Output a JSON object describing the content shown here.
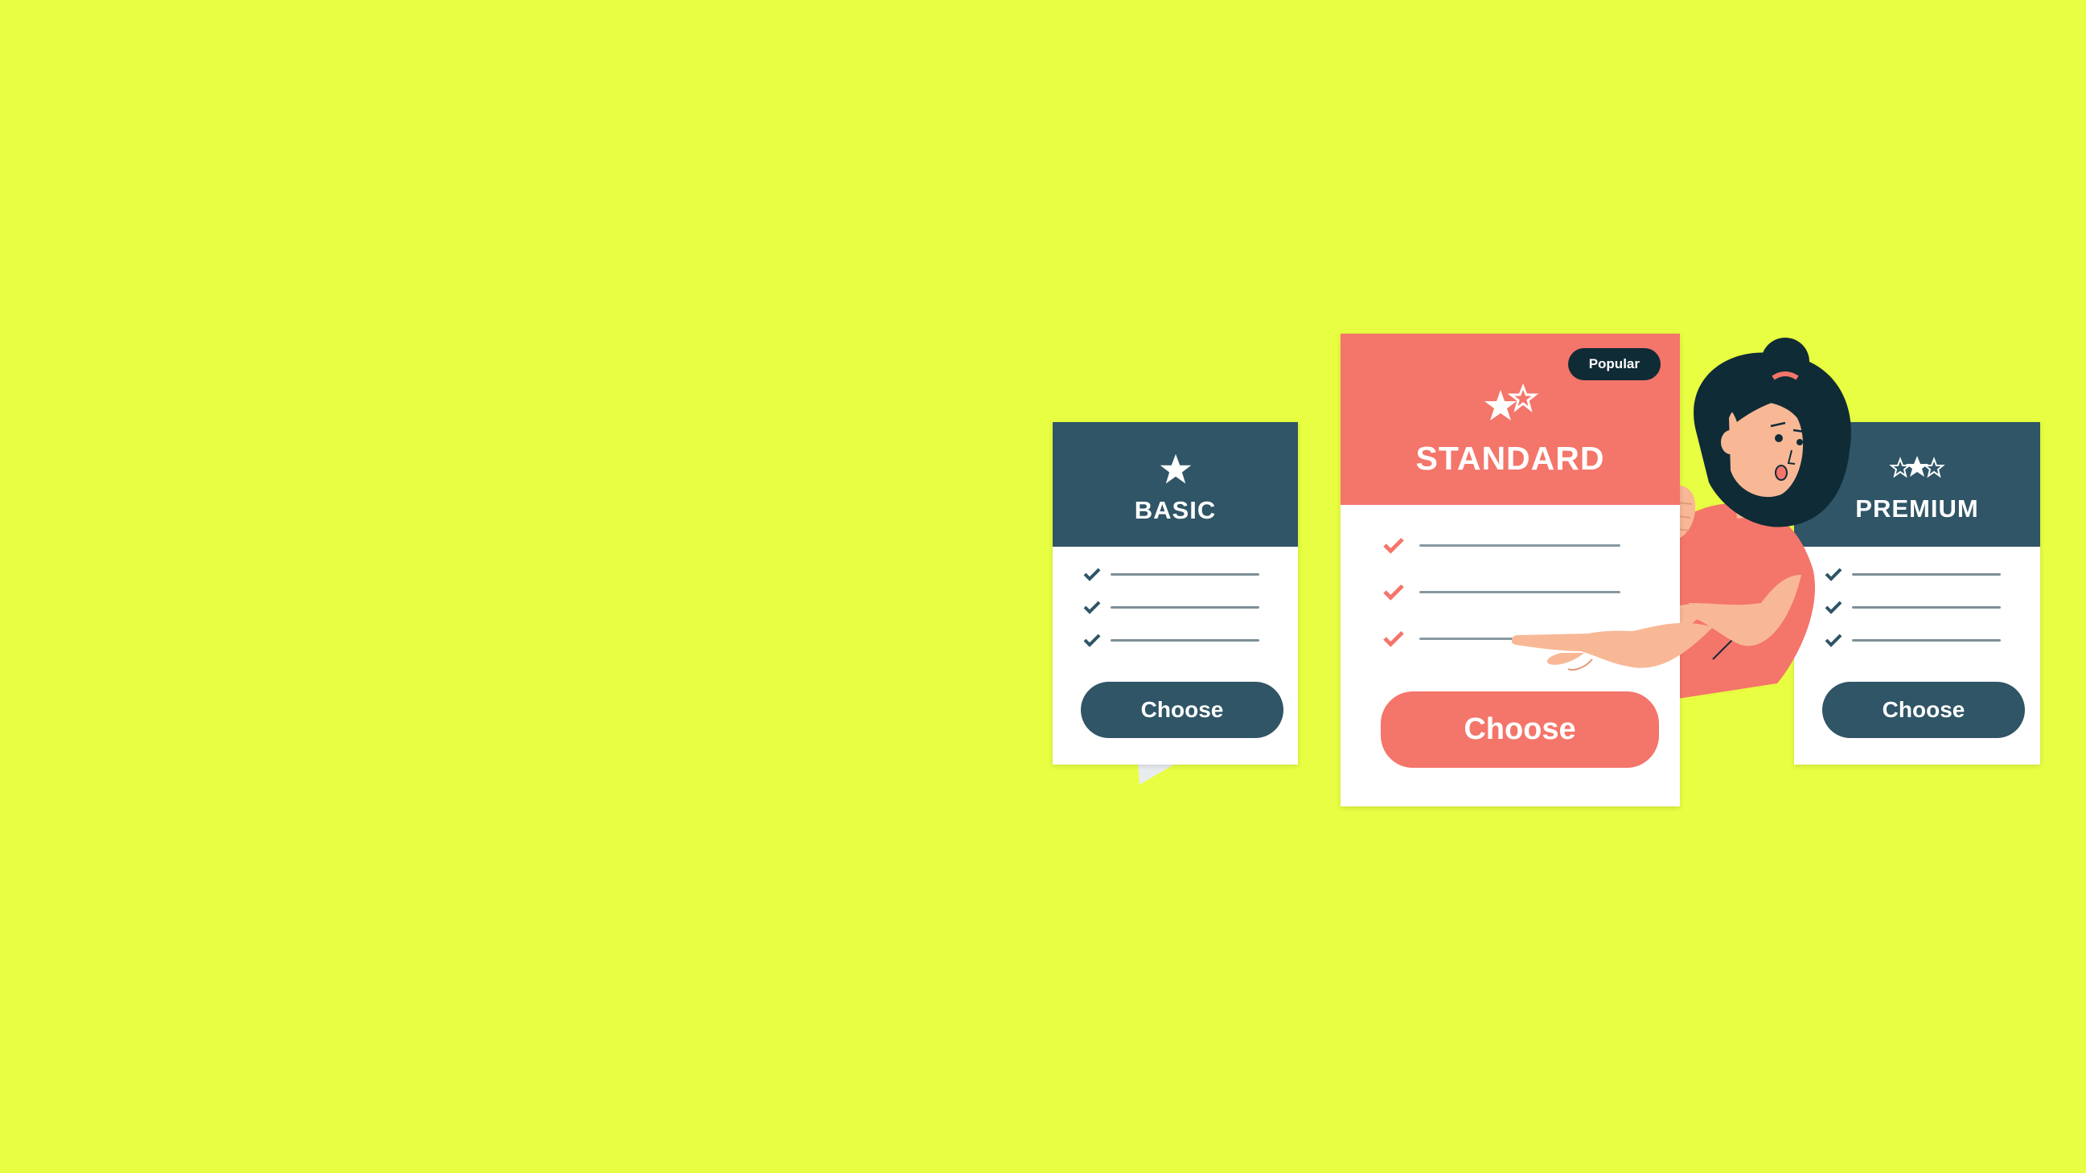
{
  "plans": {
    "basic": {
      "name": "BASIC",
      "button": "Choose",
      "icon": "single-star-icon"
    },
    "standard": {
      "name": "STANDARD",
      "button": "Choose",
      "badge": "Popular",
      "icon": "two-stars-icon"
    },
    "premium": {
      "name": "PREMIUM",
      "button": "Choose",
      "icon": "three-stars-icon"
    }
  },
  "colors": {
    "background": "#E8FE42",
    "navy": "#2F5566",
    "coral": "#F4756A",
    "dark": "#0F2B36"
  }
}
